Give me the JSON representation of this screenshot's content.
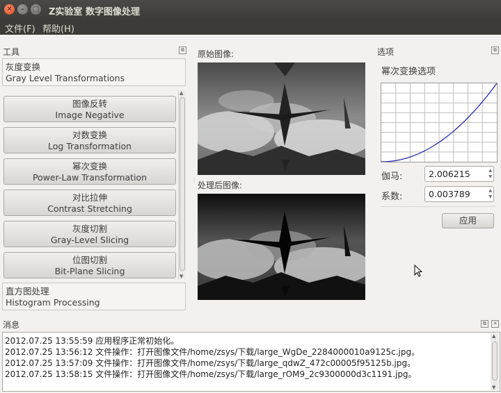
{
  "window": {
    "title": "Z实验室 数字图像处理"
  },
  "menu": {
    "file": "文件(F)",
    "help": "帮助(H)"
  },
  "tools": {
    "title": "工具",
    "categories": [
      {
        "zh": "灰度变换",
        "en": "Gray Level Transformations"
      },
      {
        "zh": "直方图处理",
        "en": "Histogram Processing"
      }
    ],
    "buttons": [
      {
        "zh": "图像反转",
        "en": "Image Negative"
      },
      {
        "zh": "对数变换",
        "en": "Log Transformation"
      },
      {
        "zh": "幂次变换",
        "en": "Power-Law Transformation"
      },
      {
        "zh": "对比拉伸",
        "en": "Contrast Stretching"
      },
      {
        "zh": "灰度切割",
        "en": "Gray-Level Slicing"
      },
      {
        "zh": "位图切割",
        "en": "Bit-Plane Slicing"
      }
    ]
  },
  "images": {
    "original_label": "原始图像:",
    "processed_label": "处理后图像:"
  },
  "options": {
    "title": "选项",
    "group_title": "幂次变换选项",
    "gamma_label": "伽马:",
    "gamma_value": "2.006215",
    "coef_label": "系数:",
    "coef_value": "0.003789",
    "apply_label": "应用"
  },
  "messages": {
    "title": "消息",
    "lines": [
      "2012.07.25 13:55:59  应用程序正常初始化。",
      "2012.07.25 13:56:12  文件操作：打开图像文件/home/zsys/下载/large_WgDe_2284000010a9125c.jpg。",
      "2012.07.25 13:57:09  文件操作：打开图像文件/home/zsys/下载/large_qdwZ_472c00005f95125b.jpg。",
      "2012.07.25 13:58:15  文件操作：打开图像文件/home/zsys/下载/large_rOM9_2c9300000d3c1191.jpg。"
    ]
  },
  "colors": {
    "curve": "#1a1aa6",
    "titlebar": "#3c3b37",
    "close": "#df4a16"
  }
}
